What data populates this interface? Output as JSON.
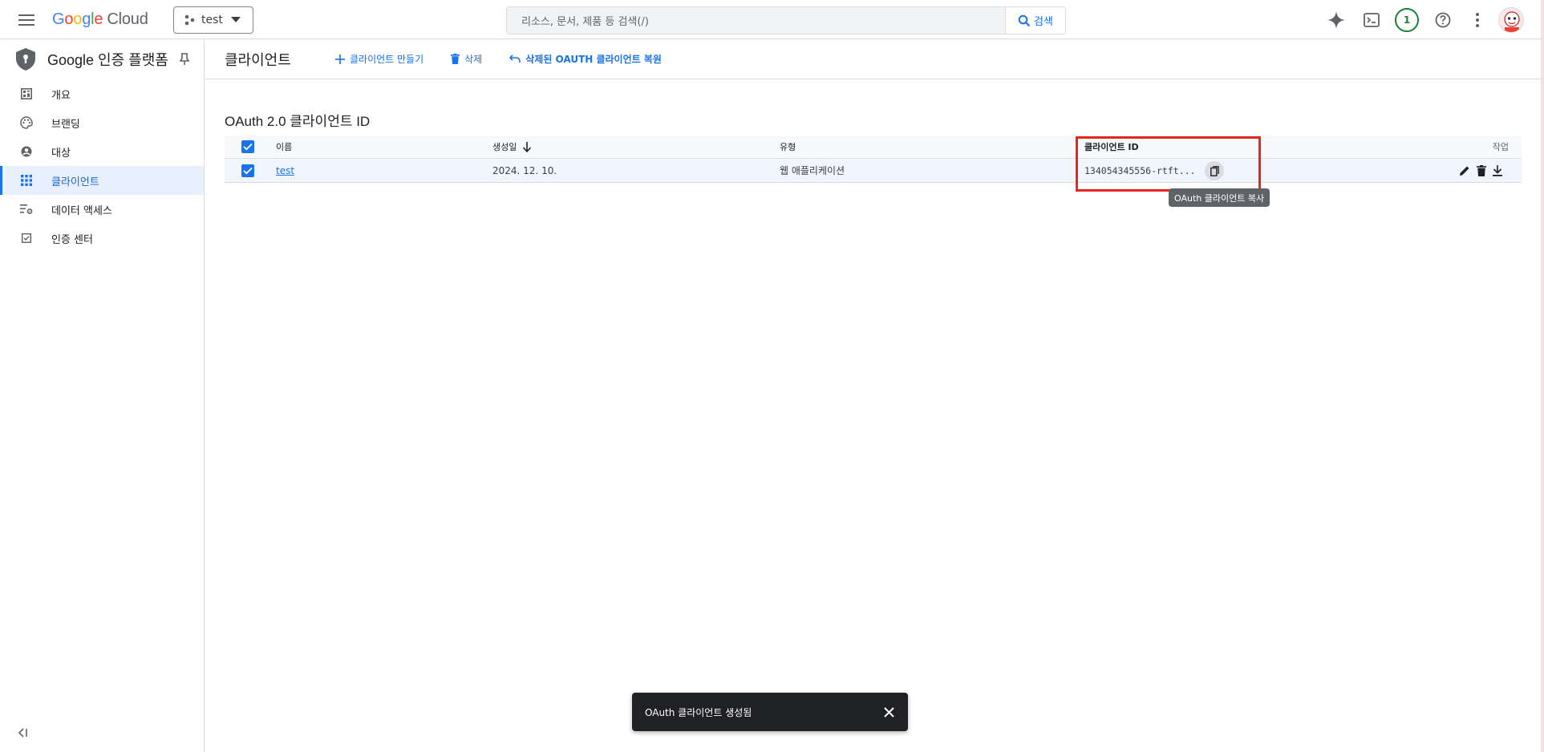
{
  "topbar": {
    "logo": {
      "g": "G",
      "o1": "o",
      "o2": "o",
      "g2": "g",
      "l": "l",
      "e": "e",
      "cloud": "Cloud"
    },
    "project_name": "test",
    "search_placeholder": "리소스, 문서, 제품 등 검색(/)",
    "search_button": "검색",
    "notification_count": "1"
  },
  "sidebar": {
    "title": "Google 인증 플랫폼",
    "items": [
      {
        "label": "개요",
        "icon": "dashboard-icon"
      },
      {
        "label": "브랜딩",
        "icon": "palette-icon"
      },
      {
        "label": "대상",
        "icon": "person-icon"
      },
      {
        "label": "클라이언트",
        "icon": "apps-grid-icon",
        "active": true
      },
      {
        "label": "데이터 액세스",
        "icon": "data-settings-icon"
      },
      {
        "label": "인증 센터",
        "icon": "checkbox-icon"
      }
    ]
  },
  "main": {
    "title": "클라이언트",
    "actions": {
      "create": "클라이언트 만들기",
      "delete": "삭제",
      "restore": "삭제된 OAUTH 클라이언트 복원"
    },
    "section_title": "OAuth 2.0 클라이언트 ID",
    "table": {
      "headers": {
        "name": "이름",
        "date": "생성일",
        "type": "유형",
        "client_id": "클라이언트 ID",
        "actions": "작업"
      },
      "rows": [
        {
          "name": "test",
          "date": "2024. 12. 10.",
          "type": "웹 애플리케이션",
          "client_id": "134054345556-rtft..."
        }
      ]
    },
    "tooltip": "OAuth 클라이언트 복사"
  },
  "snackbar": {
    "message": "OAuth 클라이언트 생성됨"
  },
  "colors": {
    "accent": "#1a73e8",
    "highlight": "#e8261c",
    "active_bg": "#e8f0fe"
  }
}
